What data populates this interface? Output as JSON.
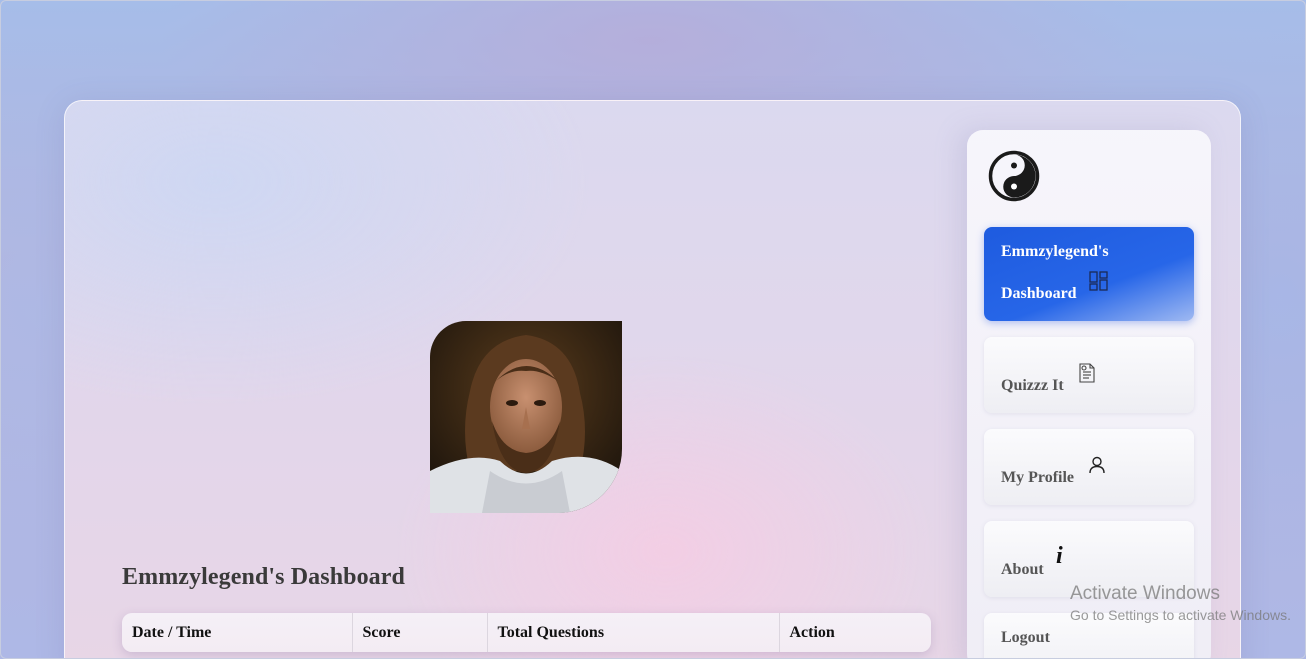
{
  "page": {
    "title": "Emmzylegend's Dashboard"
  },
  "profile": {
    "avatar_alt": "profile picture"
  },
  "table": {
    "columns": [
      "Date / Time",
      "Score",
      "Total Questions",
      "Action"
    ]
  },
  "sidebar": {
    "logo_icon": "yin-yang-icon",
    "items": [
      {
        "label": "Emmzylegend's Dashboard",
        "icon": "dashboard-grid-icon",
        "active": true
      },
      {
        "label": "Quizzz It",
        "icon": "quiz-document-icon",
        "active": false
      },
      {
        "label": "My Profile",
        "icon": "user-icon",
        "active": false
      },
      {
        "label": "About",
        "icon": "info-icon",
        "active": false
      },
      {
        "label": "Logout",
        "icon": "",
        "active": false
      }
    ]
  },
  "system": {
    "watermark_title": "Activate Windows",
    "watermark_sub": "Go to Settings to activate Windows."
  },
  "colors": {
    "accent": "#1e5bdf",
    "background": "#b3b3dd",
    "card": "#e3d6ea"
  }
}
